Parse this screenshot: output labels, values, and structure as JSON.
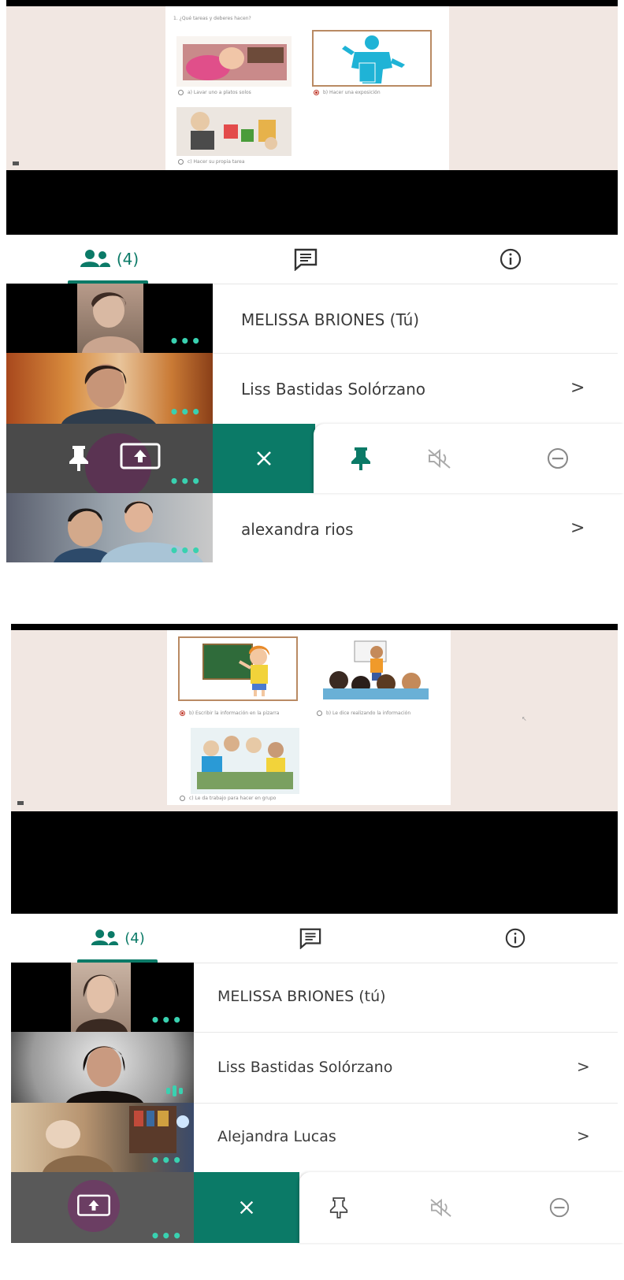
{
  "colors": {
    "accent": "#0b7a67",
    "dots": "#39d1b0",
    "stage": "#f1e7e2",
    "selected_frame": "#b98a63"
  },
  "screen1": {
    "question": "1. ¿Qué tareas y deberes hacen?",
    "options": [
      {
        "caption": "a) Lavar uno a platos solos",
        "selected": false
      },
      {
        "caption": "b) Hacer una exposición",
        "selected": true
      },
      {
        "caption": "c) Hacer su propia tarea",
        "selected": false
      }
    ],
    "tabs": {
      "people_count": "(4)",
      "people_icon": "people-icon",
      "chat_icon": "chat-icon",
      "info_icon": "info-icon"
    },
    "participants": [
      {
        "name": "MELISSA BRIONES (Tú)",
        "has_chevron": false
      },
      {
        "name": "Liss Bastidas Solórzano",
        "has_chevron": true
      },
      {
        "name": "alexandra rios",
        "has_chevron": true
      }
    ],
    "action_icons": [
      "close-icon",
      "pin-icon",
      "mute-icon",
      "remove-icon"
    ],
    "self_tile_icons": [
      "pin-icon",
      "present-icon"
    ],
    "chevron": ">"
  },
  "screen2": {
    "options": [
      {
        "caption": "b) Escribir la información en la pizarra",
        "selected": true
      },
      {
        "caption": "b) Le dice realizando la información",
        "selected": false
      },
      {
        "caption": "c) Le da trabajo para hacer en grupo",
        "selected": false
      }
    ],
    "tabs": {
      "people_count": "(4)",
      "people_icon": "people-icon",
      "chat_icon": "chat-icon",
      "info_icon": "info-icon"
    },
    "participants": [
      {
        "name": "MELISSA BRIONES (tú)",
        "has_chevron": false
      },
      {
        "name": "Liss Bastidas Solórzano",
        "has_chevron": true
      },
      {
        "name": "Alejandra Lucas",
        "has_chevron": true
      }
    ],
    "action_icons": [
      "close-icon",
      "pin-icon",
      "mute-icon",
      "remove-icon"
    ],
    "chevron": ">"
  }
}
